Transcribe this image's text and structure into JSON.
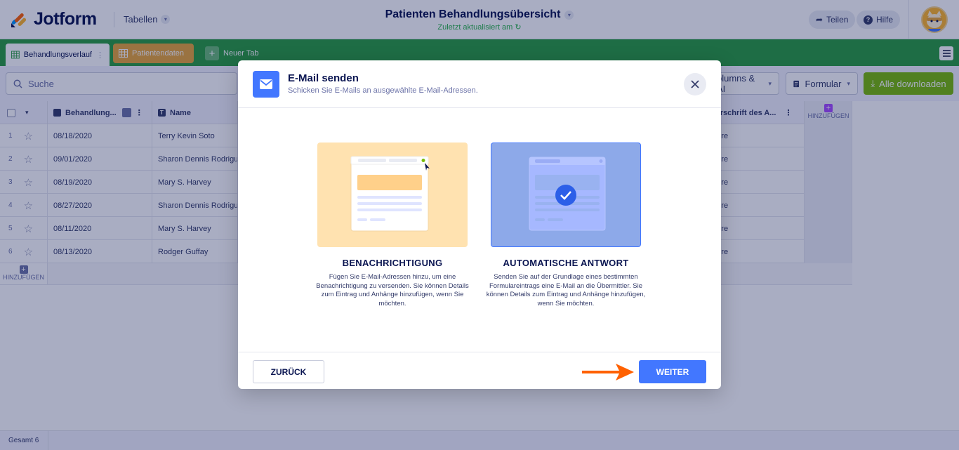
{
  "header": {
    "brand": "Jotform",
    "tables_label": "Tabellen",
    "title": "Patienten Behandlungsübersicht",
    "subtitle": "Zuletzt aktualisiert am",
    "share_label": "Teilen",
    "help_label": "Hilfe"
  },
  "tabs": [
    {
      "label": "Behandlungsverlauf"
    },
    {
      "label": "Patientendaten"
    },
    {
      "label": "Neuer Tab"
    }
  ],
  "toolbar": {
    "search_placeholder": "Suche",
    "columns_label": "olumns & AI",
    "form_label": "Formular",
    "download_label": "Alle downloaden"
  },
  "table": {
    "columns": [
      "Behandlung...",
      "Name",
      "terschrift des A..."
    ],
    "rows": [
      {
        "num": "1",
        "date": "08/18/2020",
        "name": "Terry Kevin Soto",
        "sig": "ature"
      },
      {
        "num": "2",
        "date": "09/01/2020",
        "name": "Sharon Dennis Rodrigu",
        "sig": "ature"
      },
      {
        "num": "3",
        "date": "08/19/2020",
        "name": "Mary S. Harvey",
        "sig": "ature"
      },
      {
        "num": "4",
        "date": "08/27/2020",
        "name": "Sharon Dennis Rodrigu",
        "sig": "ature"
      },
      {
        "num": "5",
        "date": "08/11/2020",
        "name": "Mary S. Harvey",
        "sig": "ature"
      },
      {
        "num": "6",
        "date": "08/13/2020",
        "name": "Rodger Guffay",
        "sig": "ature"
      }
    ],
    "add_column_label": "HINZUFÜGEN",
    "add_row_label": "HINZUFÜGEN",
    "total_label": "Gesamt 6"
  },
  "modal": {
    "title": "E-Mail senden",
    "subtitle": "Schicken Sie E-Mails an ausgewählte E-Mail-Adressen.",
    "options": [
      {
        "title": "BENACHRICHTIGUNG",
        "description": "Fügen Sie E-Mail-Adressen hinzu, um eine Benachrichtigung zu versenden. Sie können Details zum Eintrag und Anhänge hinzufügen, wenn Sie möchten.",
        "selected": false
      },
      {
        "title": "AUTOMATISCHE ANTWORT",
        "description": "Senden Sie auf der Grundlage eines bestimmten Formulareintrags eine E-Mail an die Übermittler. Sie können Details zum Eintrag und Anhänge hinzufügen, wenn Sie möchten.",
        "selected": true
      }
    ],
    "back_label": "ZURÜCK",
    "next_label": "WEITER"
  },
  "colors": {
    "accent": "#4277ff",
    "tabbar": "#2a9d3f",
    "download": "#78bb07",
    "arrow": "#ff6100"
  }
}
